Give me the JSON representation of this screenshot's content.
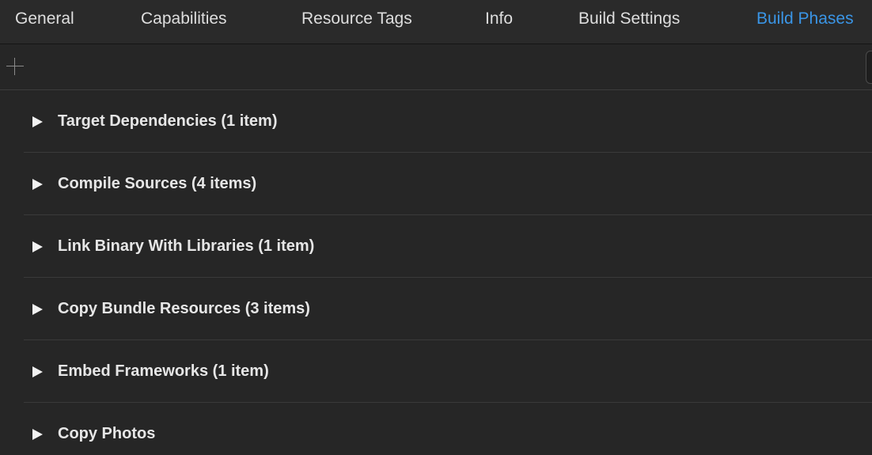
{
  "tabs": [
    {
      "label": "General",
      "active": false
    },
    {
      "label": "Capabilities",
      "active": false
    },
    {
      "label": "Resource Tags",
      "active": false
    },
    {
      "label": "Info",
      "active": false
    },
    {
      "label": "Build Settings",
      "active": false
    },
    {
      "label": "Build Phases",
      "active": true
    }
  ],
  "toolbar": {
    "add_icon": "plus-icon"
  },
  "phases": [
    {
      "label": "Target Dependencies (1 item)",
      "disclosure_icon": "disclosure-triangle-icon"
    },
    {
      "label": "Compile Sources (4 items)",
      "disclosure_icon": "disclosure-triangle-icon"
    },
    {
      "label": "Link Binary With Libraries (1 item)",
      "disclosure_icon": "disclosure-triangle-icon"
    },
    {
      "label": "Copy Bundle Resources (3 items)",
      "disclosure_icon": "disclosure-triangle-icon"
    },
    {
      "label": "Embed Frameworks (1 item)",
      "disclosure_icon": "disclosure-triangle-icon"
    },
    {
      "label": "Copy Photos",
      "disclosure_icon": "disclosure-triangle-icon"
    }
  ],
  "colors": {
    "background": "#262626",
    "active_tab": "#3a95e6",
    "tab_text": "#dedede",
    "phase_text": "#e6e6e6"
  }
}
